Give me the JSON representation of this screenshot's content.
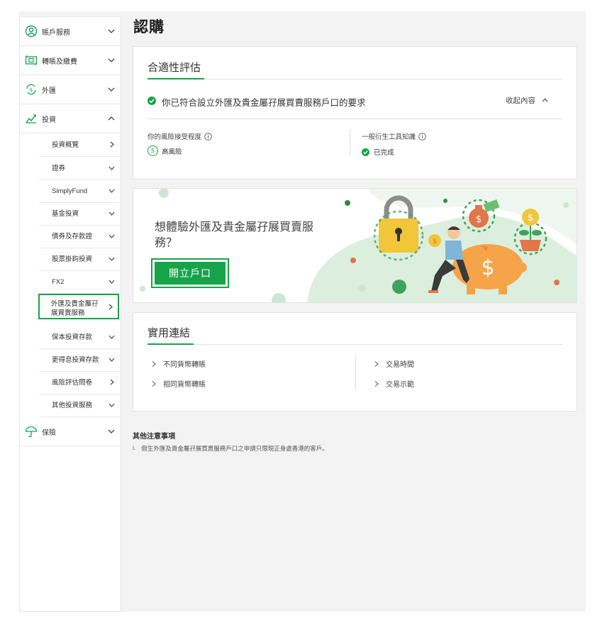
{
  "page": {
    "title": "認購"
  },
  "sidebar": {
    "main_items": [
      {
        "label": "賬戶服務",
        "icon": "user-circle-icon"
      },
      {
        "label": "轉賬及繳費",
        "icon": "transfer-icon"
      },
      {
        "label": "外匯",
        "icon": "fx-exchange-icon"
      },
      {
        "label": "投資",
        "icon": "chart-investment-icon"
      },
      {
        "label": "保險",
        "icon": "umbrella-icon"
      }
    ],
    "sub_items": [
      {
        "label": "投資概覽"
      },
      {
        "label": "證券"
      },
      {
        "label": "SimplyFund"
      },
      {
        "label": "基金投資"
      },
      {
        "label": "債券及存款證"
      },
      {
        "label": "股票掛鈎投資"
      },
      {
        "label": "FX2"
      },
      {
        "label": "外匯及貴金屬孖展買賣服務"
      },
      {
        "label": "保本投資存款"
      },
      {
        "label": "更得息投資存款"
      },
      {
        "label": "風險評估問卷"
      },
      {
        "label": "其他投資服務"
      }
    ]
  },
  "suitability": {
    "heading": "合適性評估",
    "status_text": "你已符合設立外匯及貴金屬孖展買賣服務戶口的要求",
    "collapse_label": "收起內容",
    "risk_label": "你的風險接受程度",
    "risk_level": "5",
    "risk_text": "高風險",
    "derivative_label": "一般衍生工具知識",
    "derivative_status": "已完成"
  },
  "promo": {
    "line1": "想體驗外匯及貴金屬孖展買賣服",
    "line2": "務？",
    "button": "開立戶口"
  },
  "links": {
    "heading": "實用連結",
    "left": [
      "不同貨幣轉賬",
      "相同貨幣轉賬"
    ],
    "right": [
      "交易時間",
      "交易示範"
    ]
  },
  "notes": {
    "heading": "其他注意事項",
    "item_marker": "i.",
    "item": "假生外匯及貴金屬孖展買賣服務戶口之申請只限現正身處香港的客戶。"
  },
  "colors": {
    "brand_green": "#17a34a"
  }
}
